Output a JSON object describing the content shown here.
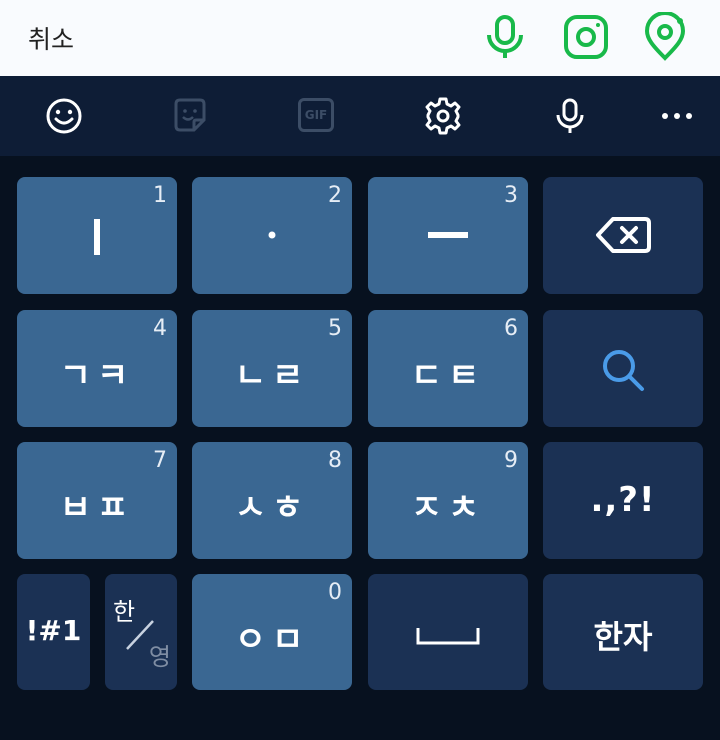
{
  "topbar": {
    "cancel_label": "취소"
  },
  "toolbar": {
    "gif_label": "GIF"
  },
  "keys": {
    "k1": {
      "number": "1",
      "label": "ㅣ"
    },
    "k2": {
      "number": "2",
      "label": "·"
    },
    "k3": {
      "number": "3",
      "label": "ㅡ"
    },
    "k4": {
      "number": "4",
      "label": "ㄱㅋ"
    },
    "k5": {
      "number": "5",
      "label": "ㄴㄹ"
    },
    "k6": {
      "number": "6",
      "label": "ㄷㅌ"
    },
    "k7": {
      "number": "7",
      "label": "ㅂㅍ"
    },
    "k8": {
      "number": "8",
      "label": "ㅅㅎ"
    },
    "k9": {
      "number": "9",
      "label": "ㅈㅊ"
    },
    "k0": {
      "number": "0",
      "label": "ㅇㅁ"
    },
    "punct": {
      "label": ".,?!"
    },
    "symbols": {
      "label": "!#1"
    },
    "lang": {
      "top": "한",
      "bottom": "영"
    },
    "hanja": {
      "label": "한자"
    }
  },
  "colors": {
    "accent_green": "#19b94a",
    "key_light": "#3a6792",
    "key_dark": "#1b3154",
    "search_blue": "#4a9be8"
  }
}
